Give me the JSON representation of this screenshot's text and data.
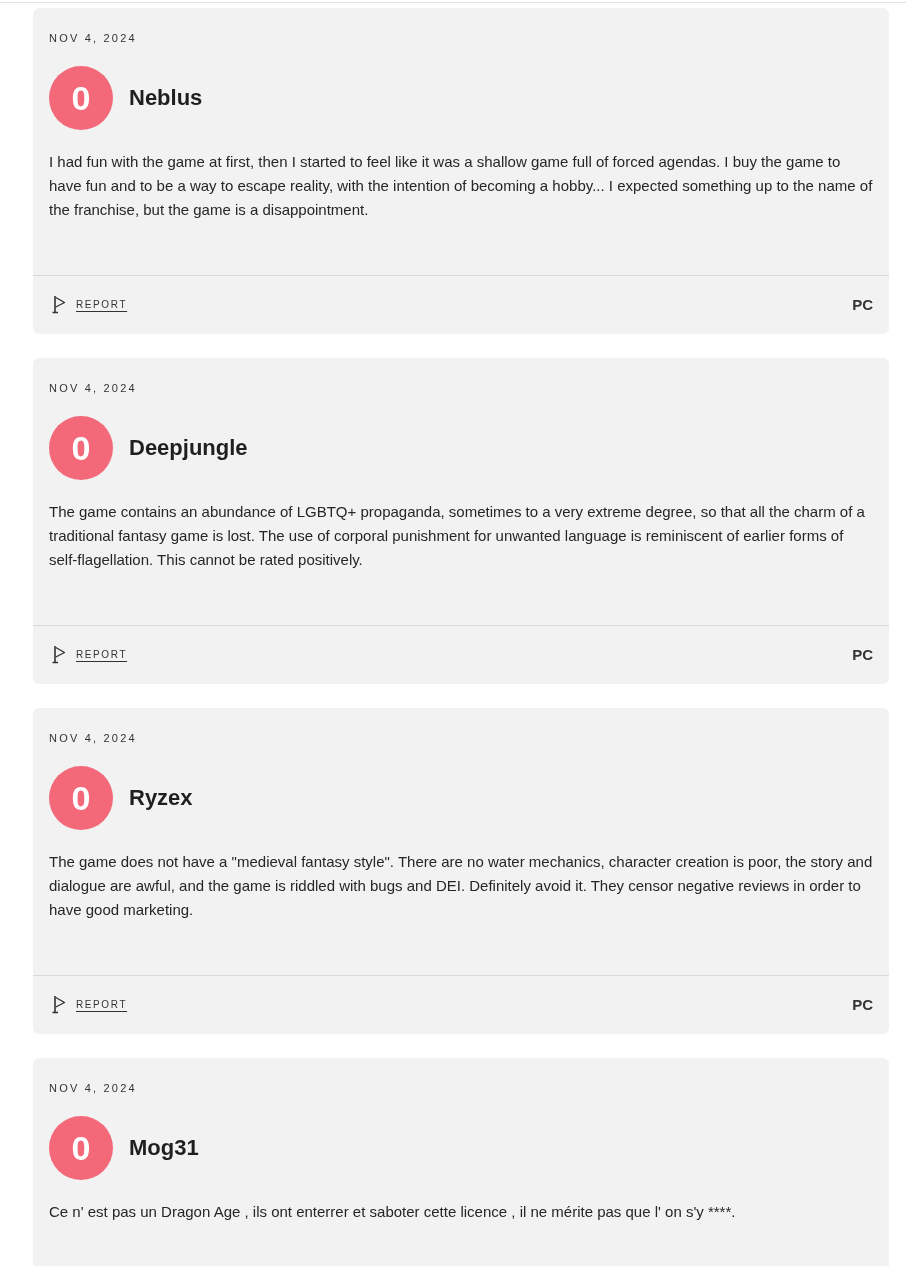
{
  "reviews": [
    {
      "date": "NOV 4, 2024",
      "score": "0",
      "author": "Neblus",
      "text": "I had fun with the game at first, then I started to feel like it was a shallow game full of forced agendas. I buy the game to have fun and to be a way to escape reality, with the intention of becoming a hobby... I expected something up to the name of the franchise, but the game is a disappointment.",
      "report": "REPORT",
      "platform": "PC"
    },
    {
      "date": "NOV 4, 2024",
      "score": "0",
      "author": "Deepjungle",
      "text": "The game contains an abundance of LGBTQ+ propaganda, sometimes to a very extreme degree, so that all the charm of a traditional fantasy game is lost. The use of corporal punishment for unwanted language is reminiscent of earlier forms of self-flagellation. This cannot be rated positively.",
      "report": "REPORT",
      "platform": "PC"
    },
    {
      "date": "NOV 4, 2024",
      "score": "0",
      "author": "Ryzex",
      "text": "The game does not have a \"medieval fantasy style\". There are no water mechanics, character creation is poor, the story and dialogue are awful, and the game is riddled with bugs and DEI. Definitely avoid it. They censor negative reviews in order to have good marketing.",
      "report": "REPORT",
      "platform": "PC"
    },
    {
      "date": "NOV 4, 2024",
      "score": "0",
      "author": "Mog31",
      "text": "Ce n' est pas un Dragon Age , ils ont enterrer et saboter cette licence , il ne mérite pas que l' on s'y ****."
    }
  ]
}
